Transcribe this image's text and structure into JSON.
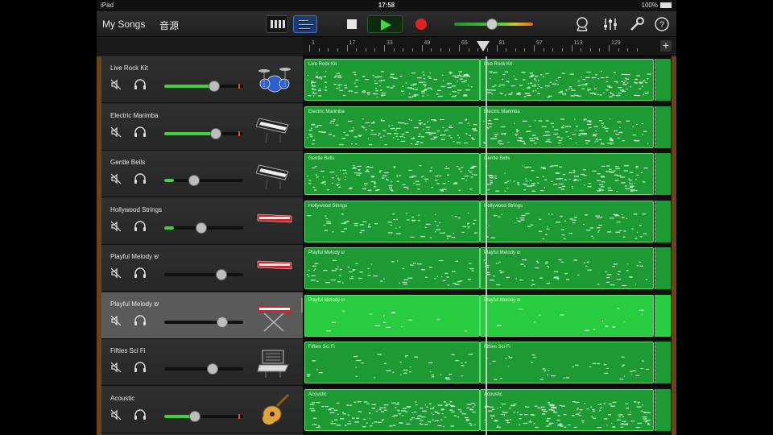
{
  "status": {
    "device": "iPad",
    "time": "17:58",
    "battery": "100%"
  },
  "toolbar": {
    "my_songs": "My Songs",
    "undo": "音源"
  },
  "ruler": {
    "labels": [
      "1",
      "17",
      "33",
      "49",
      "65",
      "81",
      "97",
      "113",
      "129"
    ],
    "add": "+"
  },
  "tracks": [
    {
      "name": "Live Rock Kit",
      "volume": 0.74,
      "meter": true,
      "icon": "drum-kit-icon",
      "selected": false
    },
    {
      "name": "Electric Marimba",
      "volume": 0.76,
      "meter": true,
      "icon": "synth-keyboard-icon",
      "selected": false
    },
    {
      "name": "Gentle Bells",
      "volume": 0.44,
      "meter": false,
      "icon": "synth-keyboard-icon",
      "selected": false
    },
    {
      "name": "Hollywood Strings",
      "volume": 0.55,
      "meter": false,
      "icon": "red-keyboard-icon",
      "selected": false
    },
    {
      "name": "Playful Melody ש",
      "volume": 0.85,
      "meter": false,
      "icon": "red-keyboard-icon",
      "selected": false
    },
    {
      "name": "Playful Melody ש",
      "volume": 0.86,
      "meter": false,
      "icon": "keyboard-stand-icon",
      "selected": true
    },
    {
      "name": "Fifties Sci Fi",
      "volume": 0.71,
      "meter": false,
      "icon": "vintage-synth-icon",
      "selected": false
    },
    {
      "name": "Acoustic",
      "volume": 0.45,
      "meter": true,
      "icon": "acoustic-guitar-icon",
      "selected": false
    }
  ],
  "regions": [
    {
      "label": "Live Rock Kit"
    },
    {
      "label": "Electric Marimba"
    },
    {
      "label": "Gentle Bells"
    },
    {
      "label": "Hollywood Strings"
    },
    {
      "label": "Playful Melody ש"
    },
    {
      "label": "Playful Melody ש"
    },
    {
      "label": "Fifties Sci Fi"
    },
    {
      "label": "Acoustic"
    }
  ],
  "colors": {
    "region": "#1d9a33",
    "region_selected": "#27cc3f",
    "accent": "#3fcf3f",
    "record": "#e02222"
  }
}
